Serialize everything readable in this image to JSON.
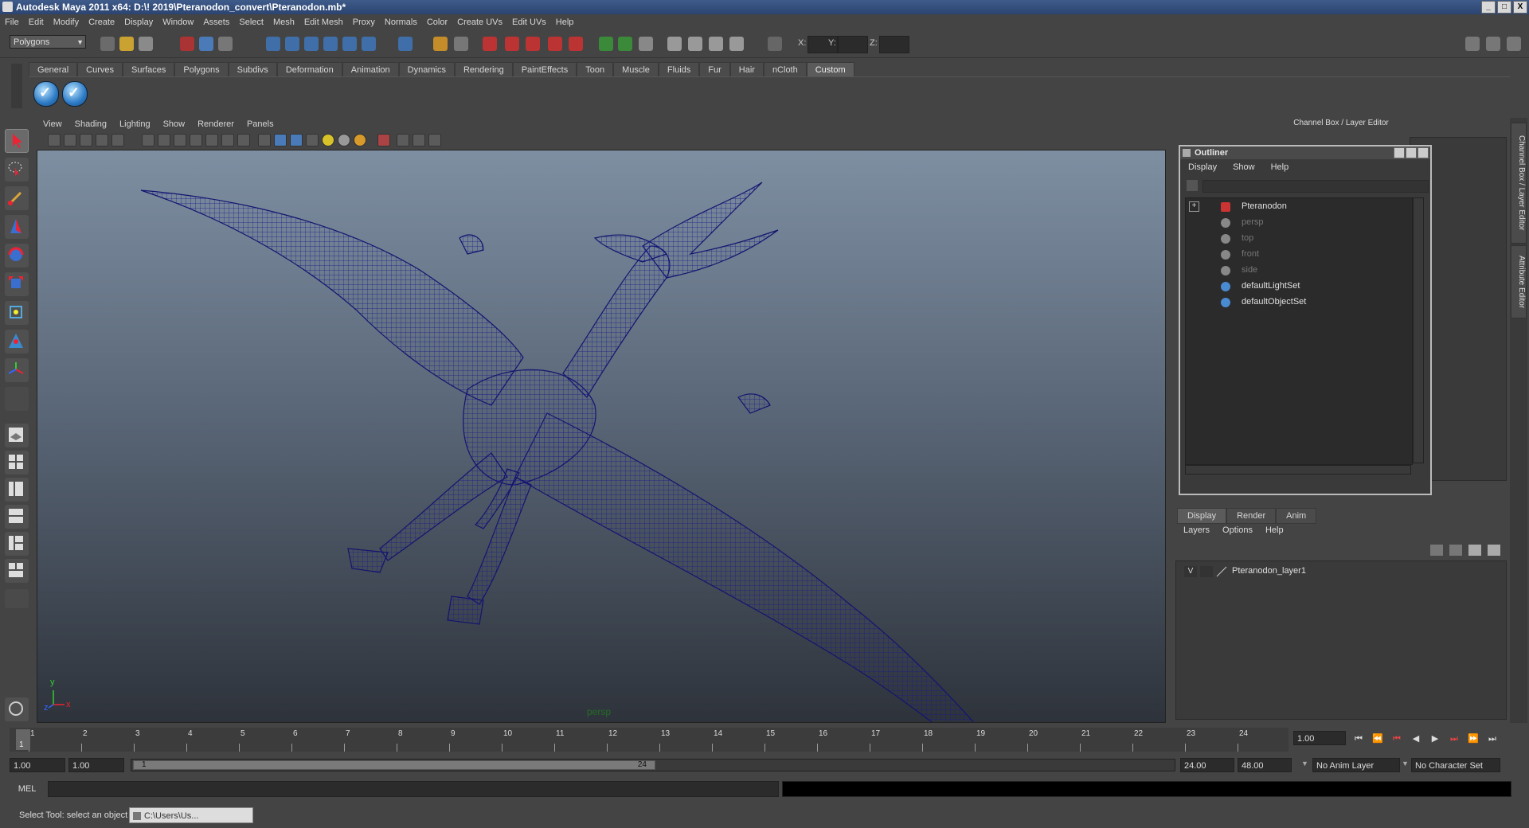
{
  "window": {
    "title": "Autodesk Maya 2011 x64: D:\\! 2019\\Pteranodon_convert\\Pteranodon.mb*",
    "min": "_",
    "max": "□",
    "close": "X"
  },
  "menubar": [
    "File",
    "Edit",
    "Modify",
    "Create",
    "Display",
    "Window",
    "Assets",
    "Select",
    "Mesh",
    "Edit Mesh",
    "Proxy",
    "Normals",
    "Color",
    "Create UVs",
    "Edit UVs",
    "Help"
  ],
  "toolbar": {
    "mode": "Polygons",
    "x_label": "X:",
    "y_label": "Y:",
    "z_label": "Z:"
  },
  "shelf": {
    "tabs": [
      "General",
      "Curves",
      "Surfaces",
      "Polygons",
      "Subdivs",
      "Deformation",
      "Animation",
      "Dynamics",
      "Rendering",
      "PaintEffects",
      "Toon",
      "Muscle",
      "Fluids",
      "Fur",
      "Hair",
      "nCloth",
      "Custom"
    ],
    "active": "Custom"
  },
  "panel": {
    "menu": [
      "View",
      "Shading",
      "Lighting",
      "Show",
      "Renderer",
      "Panels"
    ],
    "camera": "persp",
    "axis_y": "y",
    "axis_x": "x",
    "axis_z": "z"
  },
  "channel_box": {
    "title": "Channel Box / Layer Editor",
    "side_tab1": "Channel Box / Layer Editor",
    "side_tab2": "Attribute Editor"
  },
  "outliner": {
    "title": "Outliner",
    "menu": [
      "Display",
      "Show",
      "Help"
    ],
    "items": [
      {
        "label": "Pteranodon",
        "dim": false
      },
      {
        "label": "persp",
        "dim": true
      },
      {
        "label": "top",
        "dim": true
      },
      {
        "label": "front",
        "dim": true
      },
      {
        "label": "side",
        "dim": true
      },
      {
        "label": "defaultLightSet",
        "dim": false
      },
      {
        "label": "defaultObjectSet",
        "dim": false
      }
    ],
    "expand": "+"
  },
  "layer_editor": {
    "tabs": [
      "Display",
      "Render",
      "Anim"
    ],
    "active": "Display",
    "menu": [
      "Layers",
      "Options",
      "Help"
    ],
    "layer": {
      "visible": "V",
      "name": "Pteranodon_layer1"
    }
  },
  "timeline": {
    "ticks": [
      1,
      2,
      3,
      4,
      5,
      6,
      7,
      8,
      9,
      10,
      11,
      12,
      13,
      14,
      15,
      16,
      17,
      18,
      19,
      20,
      21,
      22,
      23,
      24
    ],
    "current_marker": "1",
    "current_frame": "1.00"
  },
  "range": {
    "start": "1.00",
    "playback_start": "1.00",
    "slider_start": "1",
    "slider_end": "24",
    "playback_end": "24.00",
    "end": "48.00",
    "anim_layer": "No Anim Layer",
    "character_set": "No Character Set"
  },
  "command": {
    "label": "MEL"
  },
  "status": {
    "text": "Select Tool: select an object",
    "task": "C:\\Users\\Us..."
  },
  "colors": {
    "wireframe": "#1a1a8c",
    "accent": "#2d7bc6",
    "camera_label": "#246c24"
  }
}
